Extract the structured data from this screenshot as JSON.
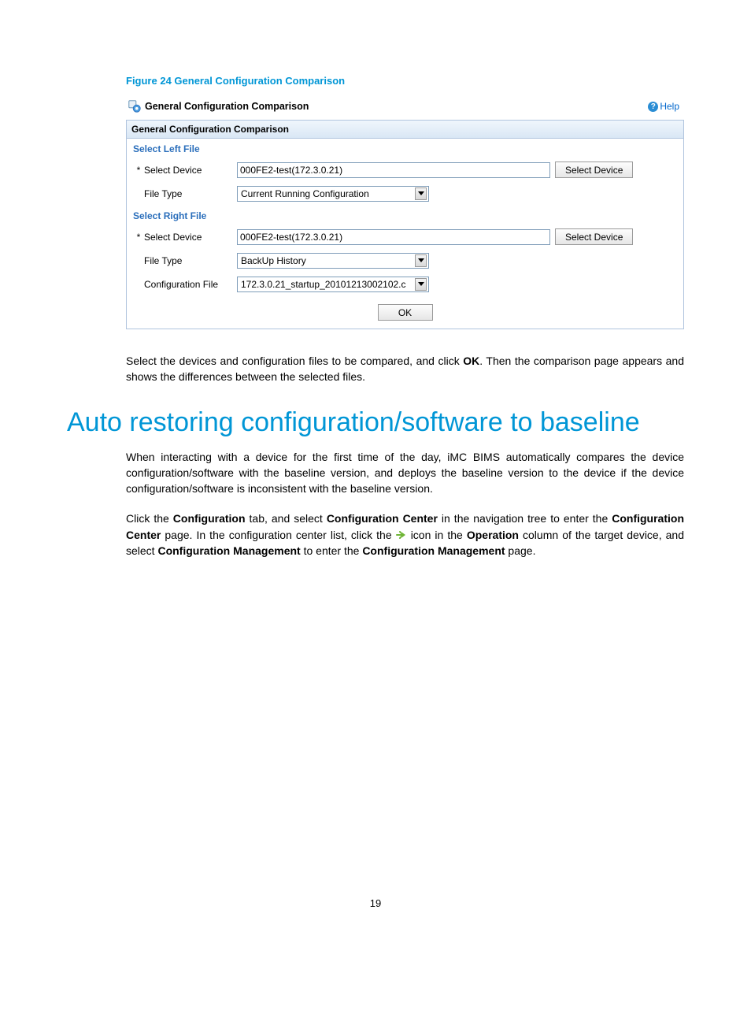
{
  "figure_caption": "Figure 24 General Configuration Comparison",
  "panel": {
    "title": "General Configuration Comparison",
    "help_label": "Help",
    "box_title": "General Configuration Comparison",
    "left_section": "Select Left File",
    "right_section": "Select Right File",
    "select_device_label": "Select Device",
    "file_type_label": "File Type",
    "config_file_label": "Configuration File",
    "device_value": "000FE2-test(172.3.0.21)",
    "select_device_btn": "Select Device",
    "left_file_type": "Current Running Configuration",
    "right_file_type": "BackUp History",
    "config_file_value": "172.3.0.21_startup_20101213002102.c",
    "ok_label": "OK",
    "asterisk": "*"
  },
  "para1_a": "Select the devices and configuration files to be compared, and click ",
  "para1_b": "OK",
  "para1_c": ". Then the comparison page appears and shows the differences between the selected files.",
  "heading": "Auto restoring configuration/software to baseline",
  "para2": "When interacting with a device for the first time of the day, iMC BIMS automatically compares the device configuration/software with the baseline version, and deploys the baseline version to the device if the device configuration/software is inconsistent with the baseline version.",
  "para3_a": "Click the ",
  "para3_b": "Configuration",
  "para3_c": " tab, and select ",
  "para3_d": "Configuration Center",
  "para3_e": " in the navigation tree to enter the ",
  "para3_f": "Configuration Center",
  "para3_g": " page. In the configuration center list, click the ",
  "para3_h": " icon in the ",
  "para3_i": "Operation",
  "para3_j": " column of the target device, and select ",
  "para3_k": "Configuration Management",
  "para3_l": " to enter the ",
  "para3_m": "Configuration Management",
  "para3_n": " page.",
  "page_number": "19"
}
